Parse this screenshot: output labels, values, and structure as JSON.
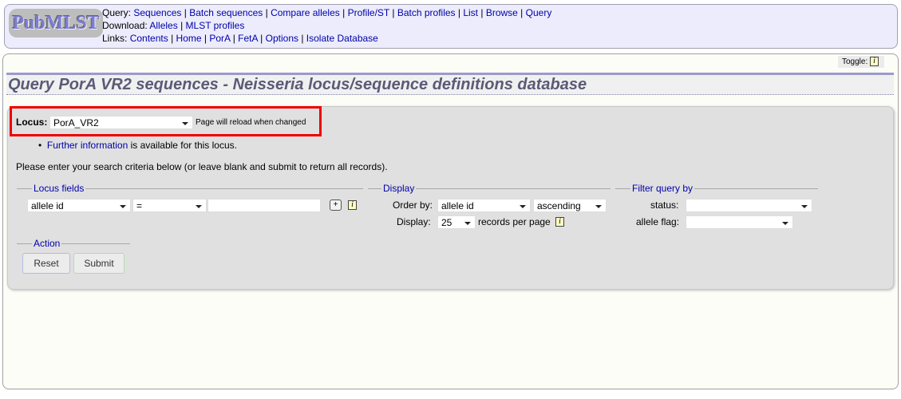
{
  "header": {
    "logo": "PubMLST",
    "query": {
      "label": "Query:",
      "links": [
        "Sequences",
        "Batch sequences",
        "Compare alleles",
        "Profile/ST",
        "Batch profiles",
        "List",
        "Browse",
        "Query"
      ]
    },
    "download": {
      "label": "Download:",
      "links": [
        "Alleles",
        "MLST profiles"
      ]
    },
    "links": {
      "label": "Links:",
      "links": [
        "Contents",
        "Home",
        "PorA",
        "FetA",
        "Options",
        "Isolate Database"
      ]
    }
  },
  "toggle": {
    "label": "Toggle:",
    "icon": "i"
  },
  "title": "Query PorA VR2 sequences - Neisseria locus/sequence definitions database",
  "locus": {
    "label": "Locus:",
    "value": "PorA_VR2",
    "note": "Page will reload when changed"
  },
  "info": {
    "link": "Further information",
    "text": " is available for this locus."
  },
  "instructions": "Please enter your search criteria below (or leave blank and submit to return all records).",
  "locus_fields": {
    "legend": "Locus fields",
    "field": "allele id",
    "operator": "=",
    "value": "",
    "add": "+",
    "info": "i"
  },
  "display": {
    "legend": "Display",
    "order_label": "Order by:",
    "order_value": "allele id",
    "direction": "ascending",
    "display_label": "Display:",
    "display_value": "25",
    "per_page": "records per page",
    "info": "i"
  },
  "filter": {
    "legend": "Filter query by",
    "status_label": "status:",
    "status_value": "",
    "flag_label": "allele flag:",
    "flag_value": ""
  },
  "action": {
    "legend": "Action",
    "reset": "Reset",
    "submit": "Submit"
  }
}
